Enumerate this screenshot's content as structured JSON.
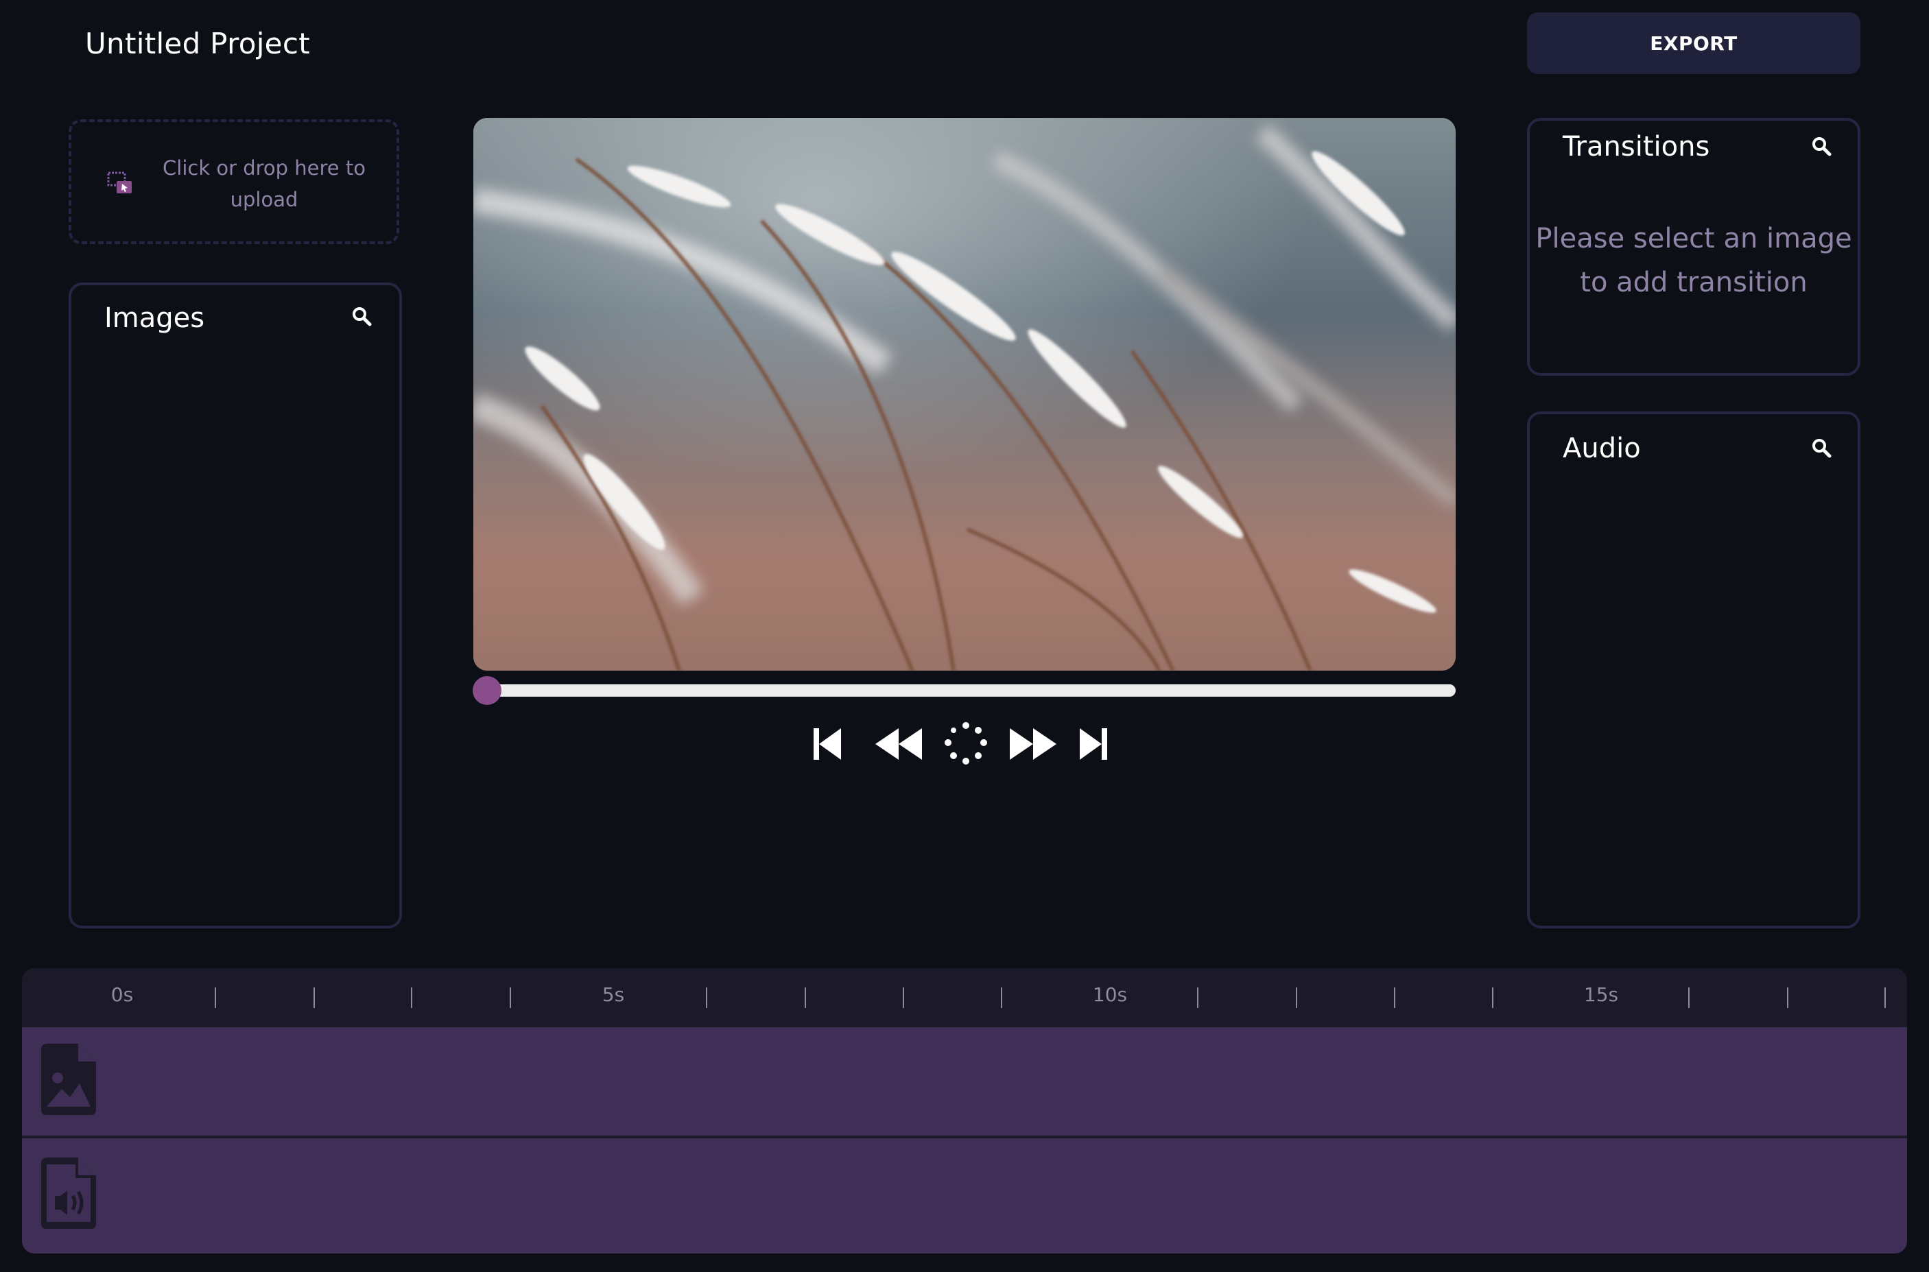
{
  "header": {
    "project_title": "Untitled Project",
    "export_label": "EXPORT"
  },
  "upload": {
    "text": "Click or drop here to upload",
    "icon": "image-upload-icon"
  },
  "images_panel": {
    "title": "Images",
    "search_icon": "search-icon"
  },
  "transitions_panel": {
    "title": "Transitions",
    "search_icon": "search-icon",
    "empty_message": "Please select an image to add transition"
  },
  "audio_panel": {
    "title": "Audio",
    "search_icon": "search-icon"
  },
  "preview": {
    "image": "snow-covered grass stalks",
    "progress": 0
  },
  "controls": {
    "skip_start_icon": "skip-to-start-icon",
    "rewind_icon": "rewind-icon",
    "loading_icon": "loading-spinner-icon",
    "fast_forward_icon": "fast-forward-icon",
    "skip_end_icon": "skip-to-end-icon"
  },
  "timeline": {
    "labels": [
      "0s",
      "5s",
      "10s",
      "15s"
    ],
    "image_track_icon": "image-file-icon",
    "audio_track_icon": "audio-file-icon"
  },
  "colors": {
    "background": "#0d0f16",
    "panel_border": "#242643",
    "accent": "#8a4d8c",
    "track": "#3f2f56",
    "muted_text": "#8f84a6"
  }
}
